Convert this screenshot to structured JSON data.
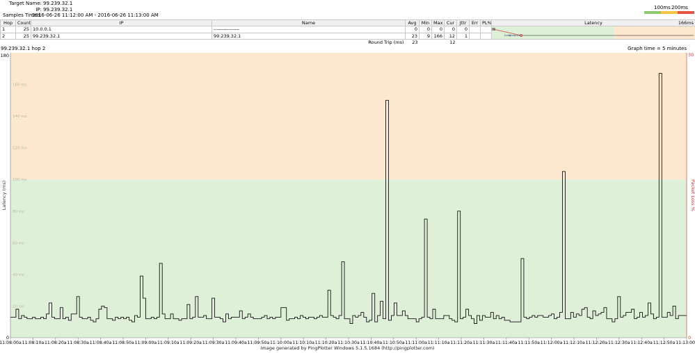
{
  "header": {
    "target_name_label": "Target Name:",
    "target_name": "99.239.32.1",
    "ip_label": "IP:",
    "ip": "99.239.32.1",
    "samples_label": "Samples Timed:",
    "samples": "2016-06-26 11:12:00 AM - 2016-06-26 11:13:00 AM",
    "legend_100": "100ms",
    "legend_200": "200ms",
    "legend_colors": [
      "#8fc96d",
      "#f1c442",
      "#e6533f"
    ]
  },
  "table": {
    "columns": [
      "Hop",
      "Count",
      "IP",
      "Name",
      "Avg",
      "Min",
      "Max",
      "Cur",
      "Jttr",
      "Err",
      "PL%",
      "Latency"
    ],
    "latency_max_label": "166ms",
    "rows": [
      {
        "hop": "1",
        "count": "25",
        "ip": "10.0.0.1",
        "name": "----------------",
        "avg": "0",
        "min": "0",
        "max": "0",
        "cur": "0",
        "jttr": "0",
        "err": "",
        "pl": ""
      },
      {
        "hop": "2",
        "count": "25",
        "ip": "99.239.32.1",
        "name": "99.239.32.1",
        "avg": "23",
        "min": "9",
        "max": "166",
        "cur": "12",
        "jttr": "1",
        "err": "",
        "pl": ""
      }
    ],
    "round_trip_label": "Round Trip (ms)",
    "round_trip_avg": "23",
    "round_trip_cur": "12"
  },
  "graph": {
    "title": "99.239.32.1 hop 2",
    "timespan": "Graph time = 5 minutes"
  },
  "chart_data": {
    "type": "line",
    "step": true,
    "ylabel": "Latency (ms)",
    "y2label": "Packet Loss %",
    "ylim": [
      0,
      180
    ],
    "y2lim": [
      0,
      30
    ],
    "yticks": [
      0,
      20,
      40,
      60,
      80,
      100,
      120,
      140,
      160,
      180
    ],
    "ytick_labels": [
      "0",
      "20 ms",
      "40 ms",
      "60 ms",
      "80 ms",
      "100 ms",
      "120 ms",
      "140 ms",
      "160 ms",
      "180"
    ],
    "y2ticks": [
      "30",
      "0"
    ],
    "bands": [
      {
        "from": 0,
        "to": 100,
        "color": "#dff0d8"
      },
      {
        "from": 100,
        "to": 180,
        "color": "#fde8cf"
      }
    ],
    "x_start_seconds": 0,
    "x_end_seconds": 300,
    "xtick_labels": [
      "11:08:00a",
      "11:08:10a",
      "11:08:20a",
      "11:08:30a",
      "11:08:40a",
      "11:08:50a",
      "11:09:00a",
      "11:09:10a",
      "11:09:20a",
      "11:09:30a",
      "11:09:40a",
      "11:09:50a",
      "11:10:00a",
      "11:10:10a",
      "11:10:20a",
      "11:10:30a",
      "11:10:40a",
      "11:10:50a",
      "11:11:00a",
      "11:11:10a",
      "11:11:20a",
      "11:11:30a",
      "11:11:40a",
      "11:11:50a",
      "11:12:00a",
      "11:12:10a",
      "11:12:20a",
      "11:12:30a",
      "11:12:40a",
      "11:12:50a",
      "11:13:00a"
    ],
    "values": [
      13,
      13,
      18,
      12,
      14,
      13,
      12,
      12,
      13,
      12,
      12,
      13,
      12,
      15,
      22,
      13,
      12,
      12,
      19,
      12,
      13,
      11,
      15,
      15,
      26,
      13,
      12,
      12,
      13,
      11,
      10,
      12,
      18,
      20,
      19,
      12,
      12,
      11,
      13,
      12,
      13,
      12,
      13,
      11,
      10,
      14,
      13,
      39,
      25,
      12,
      12,
      13,
      12,
      13,
      47,
      15,
      12,
      12,
      15,
      12,
      12,
      11,
      12,
      12,
      21,
      12,
      13,
      26,
      13,
      13,
      14,
      12,
      12,
      25,
      13,
      13,
      12,
      10,
      15,
      12,
      13,
      13,
      13,
      17,
      12,
      13,
      15,
      13,
      12,
      12,
      12,
      13,
      14,
      12,
      13,
      12,
      13,
      13,
      19,
      19,
      11,
      12,
      12,
      13,
      12,
      14,
      13,
      12,
      13,
      13,
      12,
      13,
      14,
      13,
      13,
      30,
      14,
      13,
      12,
      14,
      48,
      12,
      12,
      9,
      14,
      13,
      14,
      16,
      13,
      10,
      11,
      28,
      10,
      14,
      23,
      12,
      150,
      11,
      14,
      22,
      14,
      14,
      17,
      14,
      12,
      12,
      12,
      10,
      12,
      13,
      75,
      13,
      12,
      18,
      12,
      12,
      12,
      14,
      14,
      12,
      11,
      10,
      80,
      12,
      13,
      18,
      14,
      12,
      9,
      14,
      11,
      14,
      13,
      13,
      16,
      12,
      14,
      12,
      13,
      11,
      11,
      10,
      10,
      10,
      10,
      50,
      13,
      12,
      13,
      14,
      13,
      14,
      14,
      13,
      13,
      14,
      15,
      12,
      13,
      16,
      105,
      12,
      12,
      16,
      13,
      15,
      14,
      18,
      19,
      13,
      12,
      17,
      14,
      15,
      16,
      19,
      12,
      12,
      10,
      12,
      26,
      13,
      14,
      16,
      16,
      18,
      12,
      13,
      16,
      13,
      14,
      22,
      15,
      12,
      13,
      167,
      13,
      13,
      16,
      14,
      20,
      12,
      14,
      14,
      14
    ]
  },
  "footer": {
    "text": "Image generated by PingPlotter Windows 5.1.5.1684 (http://pingplotter.com)"
  }
}
